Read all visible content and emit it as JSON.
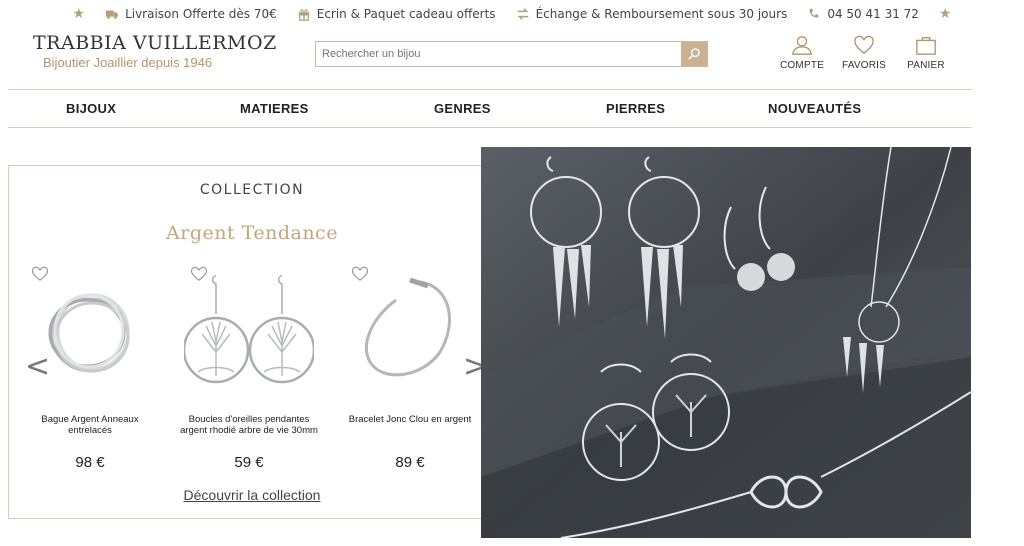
{
  "topbar": {
    "items": [
      {
        "icon": "truck-icon",
        "text": "Livraison Offerte dès 70€"
      },
      {
        "icon": "gift-icon",
        "text": "Ecrin & Paquet cadeau offerts"
      },
      {
        "icon": "exchange-icon",
        "text": "Échange & Remboursement sous 30 jours"
      },
      {
        "icon": "phone-icon",
        "text": "04 50 41 31 72"
      }
    ],
    "accent": "#b3a07f"
  },
  "brand": {
    "name": "TRABBIA VUILLERMOZ",
    "tagline": "Bijoutier Joaillier depuis 1946"
  },
  "search": {
    "placeholder": "Rechercher un bijou"
  },
  "actions": [
    {
      "icon": "user-icon",
      "label": "COMPTE"
    },
    {
      "icon": "heart-icon",
      "label": "FAVORIS"
    },
    {
      "icon": "bag-icon",
      "label": "PANIER"
    }
  ],
  "nav": [
    "BIJOUX",
    "MATIERES",
    "GENRES",
    "PIERRES",
    "NOUVEAUTÉS"
  ],
  "collection": {
    "label": "COLLECTION",
    "title": "Argent Tendance",
    "products": [
      {
        "name": "Bague Argent Anneaux entrelacés",
        "price": "98 €"
      },
      {
        "name": "Boucles d'oreilles pendantes argent rhodié arbre de vie 30mm",
        "price": "59 €"
      },
      {
        "name": "Bracelet Jonc Clou en argent",
        "price": "89 €"
      }
    ],
    "prev": "<",
    "next": ">",
    "link": "Découvrir la collection"
  },
  "colors": {
    "gold": "#c4a57c",
    "border": "#d8ccb8"
  }
}
